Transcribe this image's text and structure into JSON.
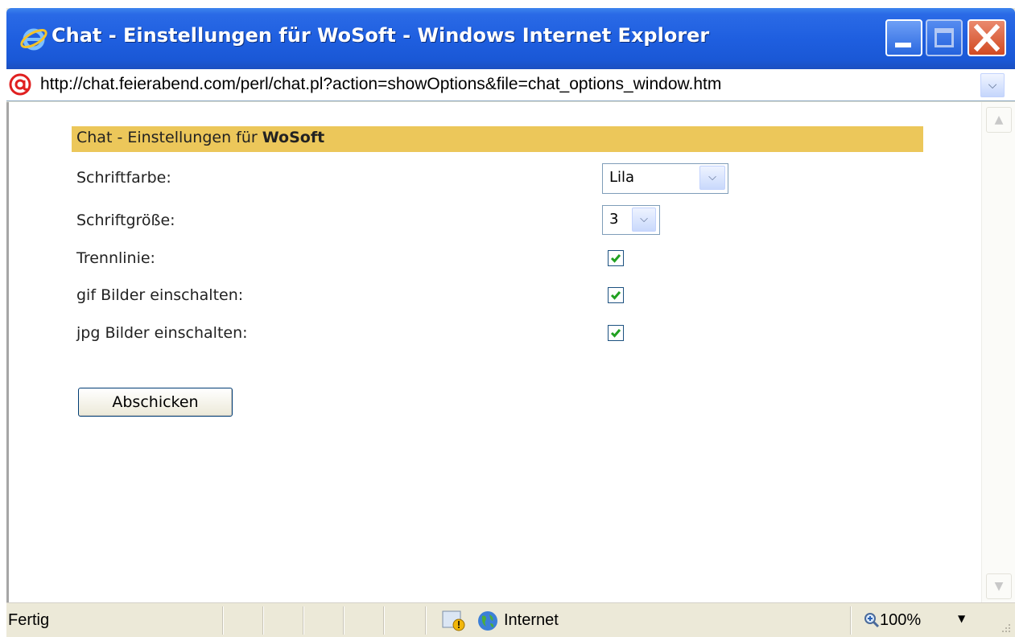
{
  "window": {
    "title": "Chat - Einstellungen für WoSoft - Windows Internet Explorer",
    "address": "http://chat.feierabend.com/perl/chat.pl?action=showOptions&file=chat_options_window.htm"
  },
  "page": {
    "heading_prefix": "Chat - Einstellungen für ",
    "heading_user": "WoSoft",
    "settings": [
      {
        "label": "Schriftfarbe:",
        "type": "select",
        "value": "Lila"
      },
      {
        "label": "Schriftgröße:",
        "type": "select",
        "value": "3"
      },
      {
        "label": "Trennlinie:",
        "type": "checkbox",
        "checked": true
      },
      {
        "label": "gif Bilder einschalten:",
        "type": "checkbox",
        "checked": true
      },
      {
        "label": "jpg Bilder einschalten:",
        "type": "checkbox",
        "checked": true
      }
    ],
    "submit_label": "Abschicken"
  },
  "statusbar": {
    "status": "Fertig",
    "zone": "Internet",
    "zoom": "100%"
  },
  "colors": {
    "titlebar": "#1f5fe0",
    "panel_header": "#ecc75a",
    "checkmark": "#21a121"
  },
  "icons": [
    "ie-logo-icon",
    "address-page-icon",
    "minimize-icon",
    "maximize-icon",
    "close-icon",
    "chevron-down-icon",
    "checkmark-icon",
    "warning-icon",
    "globe-icon",
    "zoom-icon",
    "resize-grip-icon"
  ]
}
